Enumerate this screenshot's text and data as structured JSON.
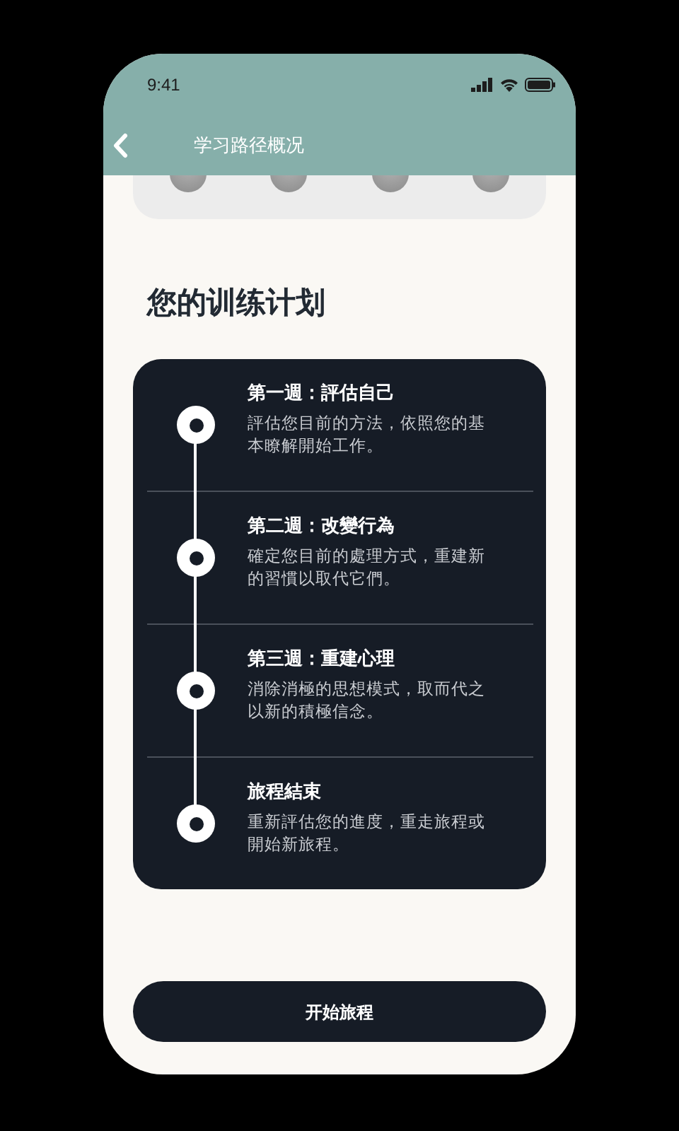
{
  "status_bar": {
    "time": "9:41"
  },
  "header": {
    "title": "学习路径概况"
  },
  "section_title": "您的训练计划",
  "steps": [
    {
      "title": "第一週：評估自己",
      "description": "評估您目前的方法，依照您的基本瞭解開始工作。"
    },
    {
      "title": "第二週：改變行為",
      "description": "確定您目前的處理方式，重建新的習慣以取代它們。"
    },
    {
      "title": "第三週：重建心理",
      "description": "消除消極的思想模式，取而代之以新的積極信念。"
    },
    {
      "title": "旅程結束",
      "description": "重新評估您的進度，重走旅程或開始新旅程。"
    }
  ],
  "start_button": {
    "label": "开始旅程"
  }
}
